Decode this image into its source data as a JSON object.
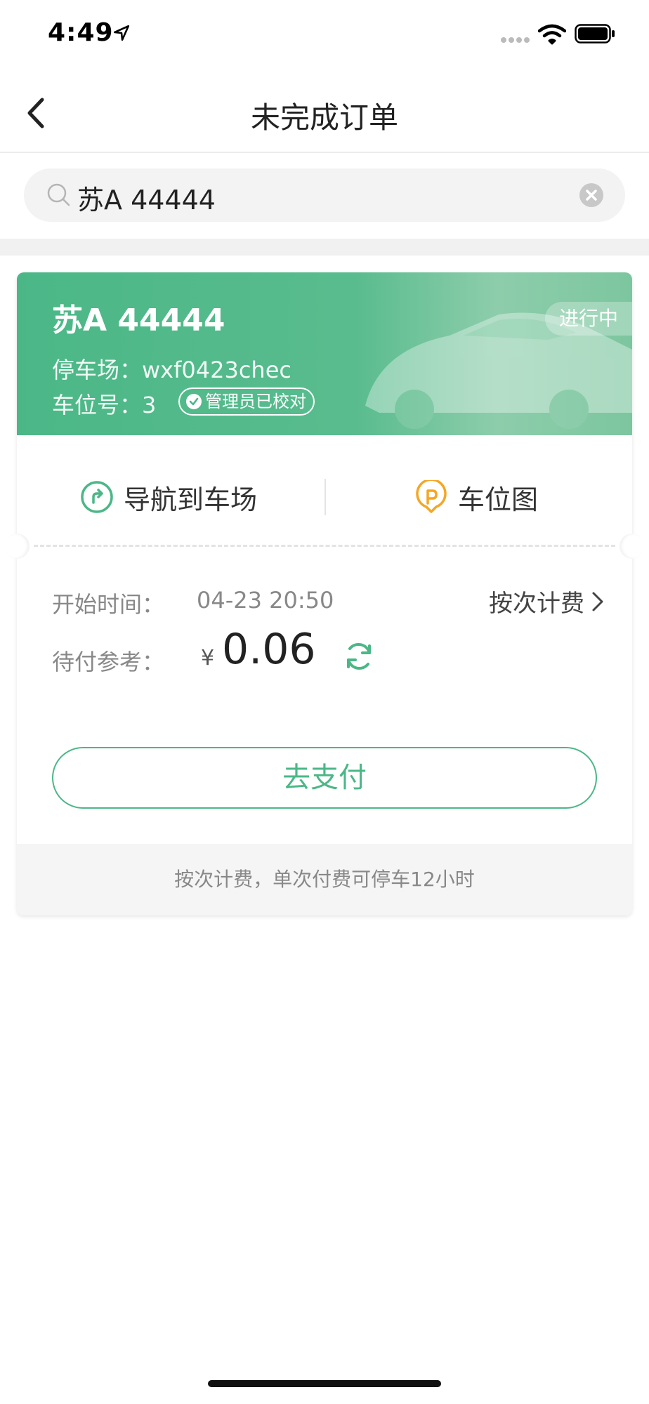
{
  "status_bar": {
    "time": "4:49"
  },
  "nav": {
    "title": "未完成订单"
  },
  "search": {
    "value": "苏A 44444"
  },
  "order": {
    "plate": "苏A 44444",
    "status": "进行中",
    "lot_line": "停车场：wxf0423chec",
    "slot_line": "车位号：3",
    "verified_badge": "管理员已校对",
    "actions": {
      "navigate": "导航到车场",
      "slot_map": "车位图"
    },
    "start_label": "开始时间：",
    "start_value": "04-23 20:50",
    "billing_mode": "按次计费",
    "due_label": "待付参考：",
    "currency": "¥",
    "amount": "0.06",
    "pay_button": "去支付",
    "footer_note": "按次计费，单次付费可停车12小时"
  },
  "colors": {
    "accent": "#4bb787",
    "navigate_icon": "#4bb787",
    "slot_map_icon": "#f5a623"
  }
}
